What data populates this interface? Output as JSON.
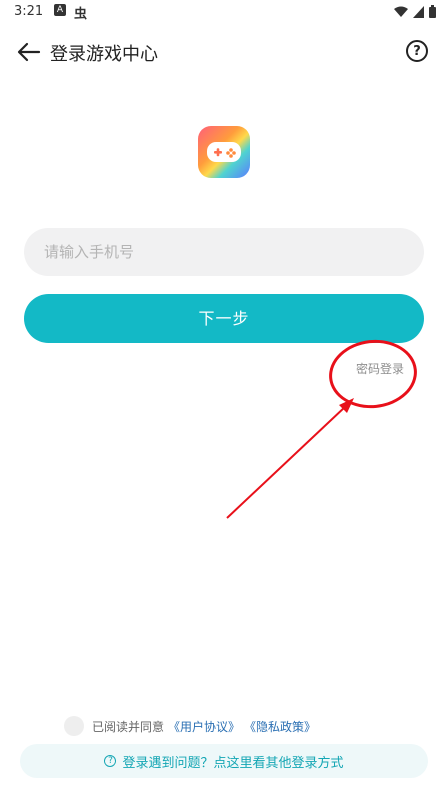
{
  "status": {
    "time": "3:21",
    "notif_a": "A",
    "notif_bug": "虫"
  },
  "header": {
    "title": "登录游戏中心",
    "help_symbol": "?"
  },
  "form": {
    "phone_placeholder": "请输入手机号",
    "next_label": "下一步",
    "password_login": "密码登录"
  },
  "agreement": {
    "prefix": "已阅读并同意",
    "user_agreement": "《用户协议》",
    "privacy_policy": "《隐私政策》"
  },
  "help": {
    "text": "登录遇到问题？点这里看其他登录方式",
    "icon_symbol": "?"
  },
  "colors": {
    "accent": "#13b9c6",
    "annotation": "#e8101a",
    "link": "#2a6fb3"
  }
}
